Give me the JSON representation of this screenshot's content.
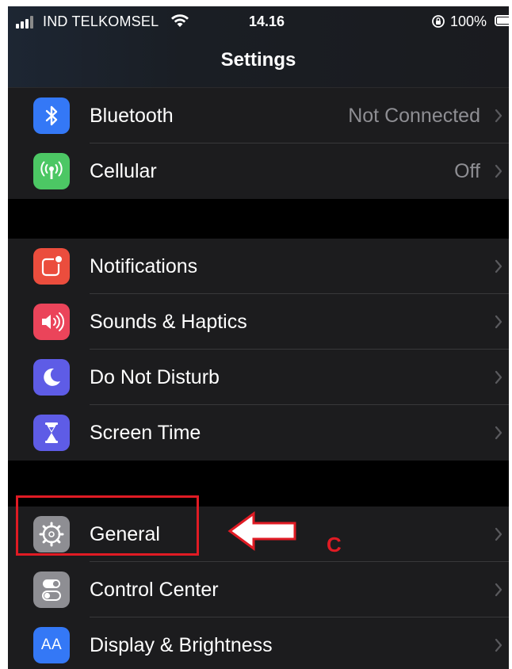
{
  "status_bar": {
    "carrier": "IND TELKOMSEL",
    "time": "14.16",
    "battery": "100%",
    "icons": [
      "signal-icon",
      "wifi-icon",
      "rotation-lock-icon",
      "battery-icon"
    ]
  },
  "nav": {
    "title": "Settings"
  },
  "groups": [
    {
      "rows": [
        {
          "label": "Bluetooth",
          "value": "Not Connected",
          "icon": "bluetooth-icon",
          "icon_color": "#3478f6"
        },
        {
          "label": "Cellular",
          "value": "Off",
          "icon": "cellular-antenna-icon",
          "icon_color": "#4cc764"
        }
      ]
    },
    {
      "rows": [
        {
          "label": "Notifications",
          "value": "",
          "icon": "notifications-icon",
          "icon_color": "#eb4d3d"
        },
        {
          "label": "Sounds & Haptics",
          "value": "",
          "icon": "speaker-icon",
          "icon_color": "#eb445a"
        },
        {
          "label": "Do Not Disturb",
          "value": "",
          "icon": "moon-icon",
          "icon_color": "#5e5ce6"
        },
        {
          "label": "Screen Time",
          "value": "",
          "icon": "hourglass-icon",
          "icon_color": "#5e5ce6"
        }
      ]
    },
    {
      "rows": [
        {
          "label": "General",
          "value": "",
          "icon": "gear-icon",
          "icon_color": "#8e8e93"
        },
        {
          "label": "Control Center",
          "value": "",
          "icon": "toggles-icon",
          "icon_color": "#8e8e93"
        },
        {
          "label": "Display & Brightness",
          "value": "",
          "icon": "text-size-icon",
          "icon_color": "#3478f6",
          "icon_text": "AA"
        }
      ]
    }
  ],
  "annotation": {
    "letter": "C",
    "color": "#e01b24",
    "target": "General"
  }
}
